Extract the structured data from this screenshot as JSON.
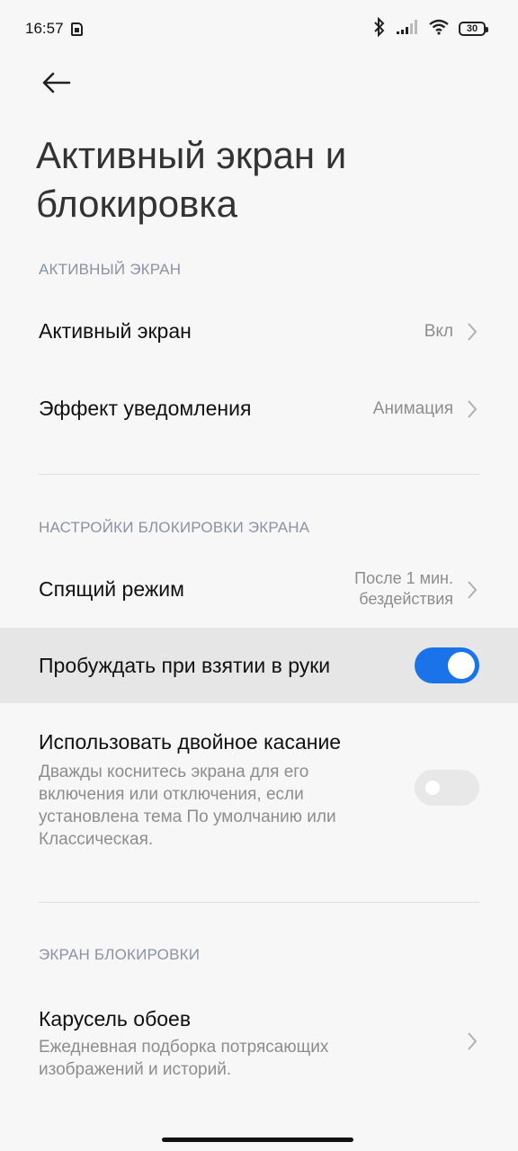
{
  "status": {
    "time": "16:57",
    "battery": "30"
  },
  "header": {
    "title_line1": "Активный экран и",
    "title_line2": "блокировка"
  },
  "sections": {
    "aod_header": "АКТИВНЫЙ ЭКРАН",
    "lock_settings_header": "НАСТРОЙКИ БЛОКИРОВКИ ЭКРАНА",
    "lock_screen_header": "ЭКРАН БЛОКИРОВКИ"
  },
  "items": {
    "aod": {
      "title": "Активный экран",
      "value": "Вкл"
    },
    "notification_effect": {
      "title": "Эффект уведомления",
      "value": "Анимация"
    },
    "sleep": {
      "title": "Спящий режим",
      "value_line1": "После 1 мин.",
      "value_line2": "бездействия"
    },
    "raise_to_wake": {
      "title": "Пробуждать при взятии в руки",
      "enabled": true
    },
    "double_tap": {
      "title": "Использовать двойное касание",
      "sub_line1": "Дважды коснитесь экрана для его",
      "sub_line2": "включения или отключения, если",
      "sub_line3": "установлена тема По умолчанию или",
      "sub_line4": "Классическая.",
      "enabled": false
    },
    "wallpaper_carousel": {
      "title": "Карусель обоев",
      "sub_line1": "Ежедневная подборка потрясающих",
      "sub_line2": "изображений и историй."
    }
  },
  "colors": {
    "accent": "#1a73e8",
    "background": "#f7f7f7",
    "highlight": "#e6e6e6",
    "secondary_text": "#8d8d8d",
    "section_header": "#8a93a3"
  }
}
